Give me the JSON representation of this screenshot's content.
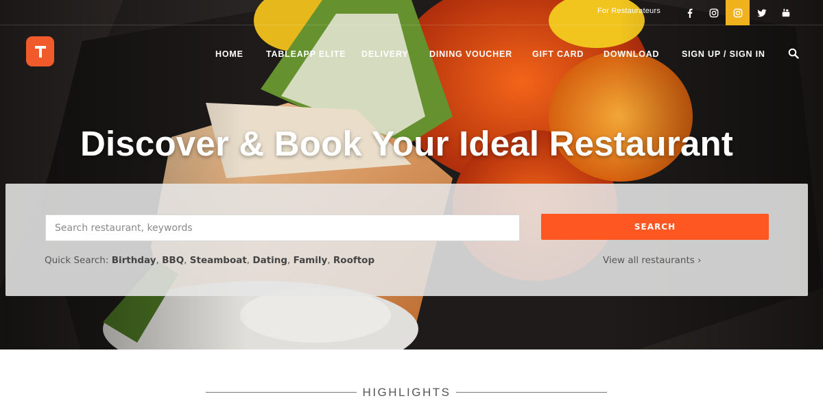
{
  "topbar": {
    "for_restaurateurs": "For Restaurateurs",
    "social": [
      {
        "name": "facebook-icon"
      },
      {
        "name": "instagram-icon"
      },
      {
        "name": "instagram-icon"
      },
      {
        "name": "twitter-icon"
      },
      {
        "name": "youtube-icon"
      }
    ],
    "active_color": "#f0b21c"
  },
  "brand": {
    "logo_letter": "T",
    "color": "#f15a2b"
  },
  "nav": {
    "items": [
      "HOME",
      "TABLEAPP ELITE",
      "DELIVERY",
      "DINING VOUCHER",
      "GIFT CARD",
      "DOWNLOAD",
      "SIGN UP / SIGN IN"
    ]
  },
  "hero": {
    "headline": "Discover & Book Your Ideal Restaurant"
  },
  "search": {
    "placeholder": "Search restaurant, keywords",
    "button_label": "SEARCH",
    "button_color": "#ff5722",
    "quick_label": "Quick Search:",
    "quick_tags": [
      "Birthday",
      "BBQ",
      "Steamboat",
      "Dating",
      "Family",
      "Rooftop"
    ],
    "view_all": "View all restaurants ›"
  },
  "section": {
    "highlights": "HIGHLIGHTS"
  }
}
